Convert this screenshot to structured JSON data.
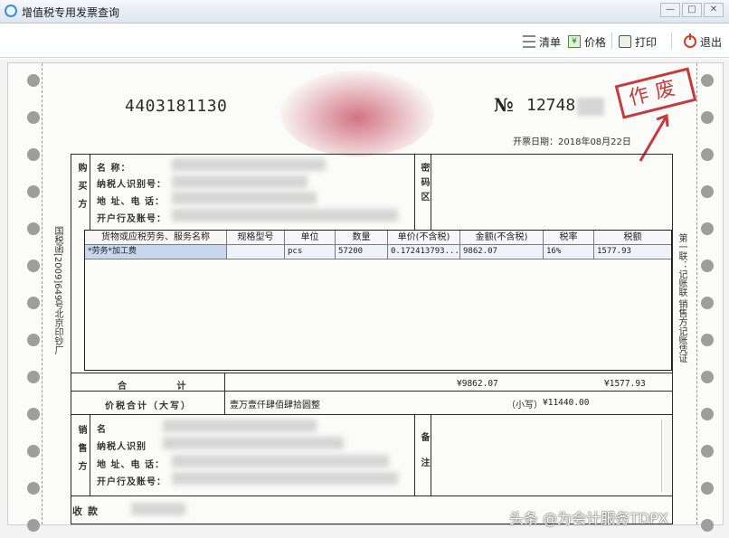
{
  "window": {
    "title": "增值税专用发票查询",
    "controls": [
      "—",
      "□",
      "✕"
    ]
  },
  "toolbar": {
    "list_label": "清单",
    "price_label": "价格",
    "print_label": "打印",
    "exit_label": "退出"
  },
  "invoice": {
    "code": "4403181130",
    "number_label": "№",
    "number": "12748",
    "void_stamp": "作废",
    "issue_date": "开票日期：2018年08月22日",
    "side_left": "国税函[2009]649号北京印钞厂",
    "side_right": "第一联：记账联 销售方记账凭证",
    "buyer": {
      "section_label": "购买方",
      "name_label": "名      称：",
      "tax_id_label": "纳税人识别号：",
      "address_label": "地 址、电 话：",
      "bank_label": "开户行及账号：",
      "password_area_label": "密码区"
    },
    "goods_table": {
      "headers": [
        "货物或应税劳务、服务名称",
        "规格型号",
        "单位",
        "数量",
        "单价(不含税)",
        "金额(不含税)",
        "税率",
        "税额"
      ],
      "rows": [
        [
          "*劳务*加工费",
          "",
          "pcs",
          "57200",
          "0.172413793...",
          "9862.07",
          "16%",
          "1577.93"
        ]
      ]
    },
    "total": {
      "label": "合  计",
      "amount": "¥9862.07",
      "tax": "¥1577.93"
    },
    "price_tax_total": {
      "label": "价税合计（大写）",
      "in_words": "壹万壹仟肆佰肆拾圆整",
      "small_label": "（小写）",
      "small_value": "¥11440.00"
    },
    "seller": {
      "section_label": "销售方",
      "name_label": "名",
      "tax_id_label": "纳税人识别",
      "address_label": "地 址、电 话：",
      "bank_label": "开户行及账号：",
      "remark_label": "备注"
    },
    "footer_label": "收款"
  },
  "watermark": "头条 @为会计服务TDPX"
}
